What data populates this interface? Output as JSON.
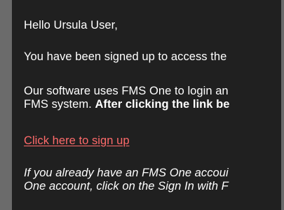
{
  "email": {
    "greeting": "Hello Ursula User,",
    "intro": "You have been signed up to access the",
    "paragraph2": {
      "line1": "Our software uses FMS One to login an",
      "line2_regular": "FMS system. ",
      "line2_bold": "After clicking the link be"
    },
    "signup_link": "Click here to sign up",
    "paragraph4": {
      "line1": "If you already have an FMS One accoui",
      "line2": "One account, click on the Sign In with F"
    }
  }
}
